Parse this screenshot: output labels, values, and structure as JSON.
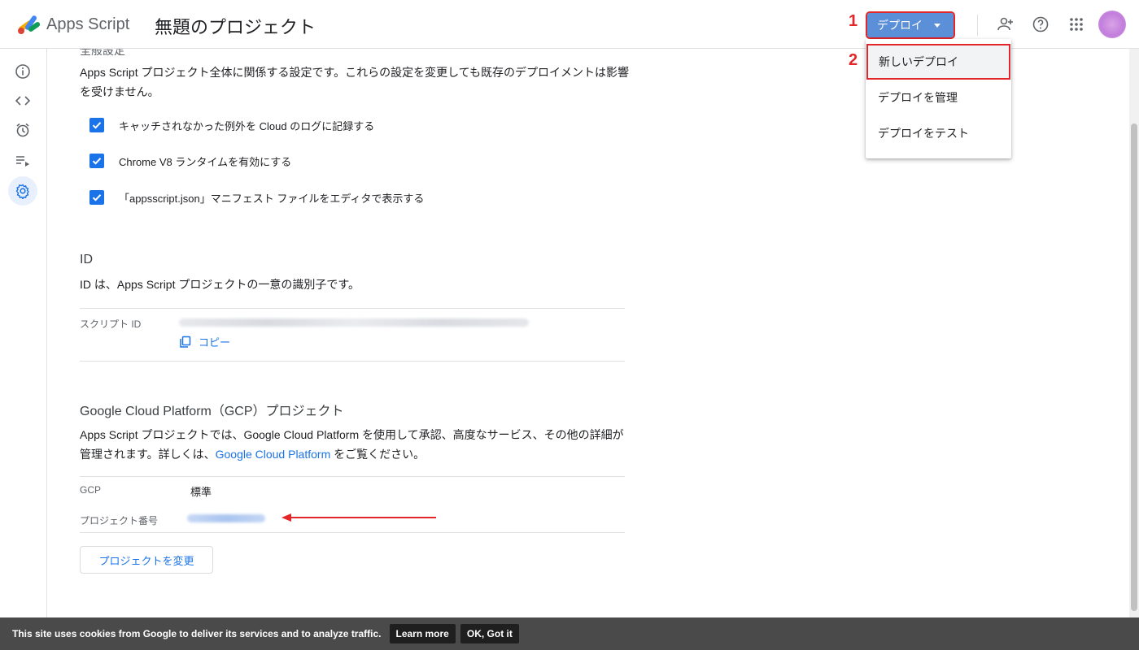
{
  "header": {
    "app_name": "Apps Script",
    "project_title": "無題のプロジェクト",
    "deploy_label": "デプロイ",
    "step1": "1",
    "step2": "2"
  },
  "deploy_menu": {
    "items": [
      {
        "label": "新しいデプロイ"
      },
      {
        "label": "デプロイを管理"
      },
      {
        "label": "デプロイをテスト"
      }
    ]
  },
  "general": {
    "heading_cut": "全般設定",
    "description": "Apps Script プロジェクト全体に関係する設定です。これらの設定を変更しても既存のデプロイメントは影響を受けません。",
    "checkboxes": [
      {
        "label": "キャッチされなかった例外を Cloud のログに記録する",
        "checked": true
      },
      {
        "label": "Chrome V8 ランタイムを有効にする",
        "checked": true
      },
      {
        "label": "「appsscript.json」マニフェスト ファイルをエディタで表示する",
        "checked": true
      }
    ]
  },
  "id_section": {
    "title": "ID",
    "description": "ID は、Apps Script プロジェクトの一意の識別子です。",
    "script_id_label": "スクリプト ID",
    "copy_label": "コピー"
  },
  "gcp_section": {
    "title": "Google Cloud Platform（GCP）プロジェクト",
    "description_pre": "Apps Script プロジェクトでは、Google Cloud Platform を使用して承認、高度なサービス、その他の詳細が管理されます。詳しくは、",
    "description_link": "Google Cloud Platform",
    "description_post": " をご覧ください。",
    "gcp_label": "GCP",
    "gcp_value": "標準",
    "project_number_label": "プロジェクト番号",
    "change_button": "プロジェクトを変更"
  },
  "cookie_bar": {
    "text": "This site uses cookies from Google to deliver its services and to analyze traffic.",
    "learn_more": "Learn more",
    "ok": "OK, Got it"
  },
  "colors": {
    "accent": "#1a73e8",
    "deploy_button": "#5b8fd8",
    "annotation_red": "#e3262a"
  }
}
